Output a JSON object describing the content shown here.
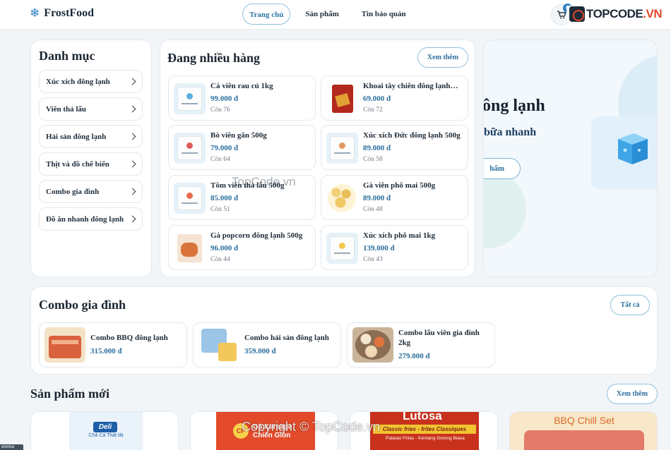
{
  "header": {
    "brand_icon": "snowflake-icon",
    "brand": "FrostFood",
    "nav": [
      "Trang chủ",
      "Sản phẩm",
      "Tin bảo quản"
    ],
    "cart_count": "0",
    "watermark_logo": "TOPCODE.VN"
  },
  "categories": {
    "title": "Danh mục",
    "items": [
      "Xúc xích đông lạnh",
      "Viên thả lẩu",
      "Hải sản đông lạnh",
      "Thịt và đồ chế biến",
      "Combo gia đình",
      "Đồ ăn nhanh đông lạnh"
    ]
  },
  "stock": {
    "title": "Đang nhiều hàng",
    "more": "Xem thêm",
    "products": [
      {
        "name": "Cá viên rau củ 1kg",
        "price": "99.000 đ",
        "stock": "Còn 76"
      },
      {
        "name": "Khoai tây chiên đông lạnh…",
        "price": "69.000 đ",
        "stock": "Còn 72"
      },
      {
        "name": "Bò viên gân 500g",
        "price": "79.000 đ",
        "stock": "Còn 64"
      },
      {
        "name": "Xúc xích Đức đông lạnh 500g",
        "price": "89.000 đ",
        "stock": "Còn 58"
      },
      {
        "name": "Tôm viên thả lẩu 500g",
        "price": "85.000 đ",
        "stock": "Còn 51"
      },
      {
        "name": "Gà viên phô mai 500g",
        "price": "89.000 đ",
        "stock": "Còn 48"
      },
      {
        "name": "Gà popcorn đông lạnh 500g",
        "price": "96.000 đ",
        "stock": "Còn 44"
      },
      {
        "name": "Xúc xích phô mai 1kg",
        "price": "139.000 đ",
        "stock": "Còn 43"
      }
    ]
  },
  "hero": {
    "title": "phẩm đông lạnh",
    "subtitle": "o bữa nhanh",
    "button": "hẩm"
  },
  "combo": {
    "title": "Combo gia đình",
    "all": "Tất cả",
    "items": [
      {
        "name": "Combo BBQ đông lạnh",
        "price": "315.000 đ"
      },
      {
        "name": "Combo hải sản đông lạnh",
        "price": "359.000 đ"
      },
      {
        "name": "Combo lẩu viên gia đình 2kg",
        "price": "279.000 đ"
      }
    ]
  },
  "new_products": {
    "title": "Sản phẩm mới",
    "more": "Xem thêm",
    "art_labels": [
      "Deli",
      "Chả Cá Thát lát",
      "CP",
      "Gà Karaage Chiên Giòn",
      "Lutosa",
      "Classic fries - frites Classiques",
      "Patatas Fritas - Kentang Goreng Biasa",
      "BBQ Chill Set"
    ]
  },
  "overlays": {
    "mid_watermark": "TopCode.vn",
    "copyright": "Copyright © TopCode.vn",
    "side_tag": "erence"
  }
}
